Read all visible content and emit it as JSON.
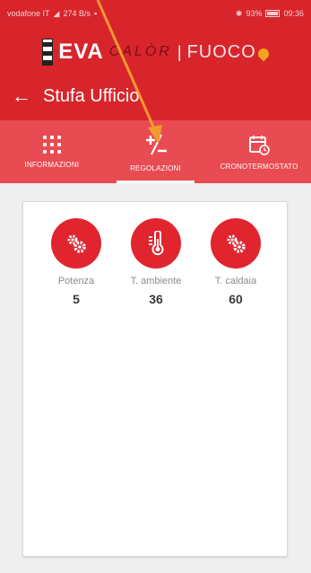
{
  "status_bar": {
    "carrier": "vodafone IT",
    "speed": "274 B/s",
    "battery": "93%",
    "time": "09:36"
  },
  "brand": {
    "eva": "EVA",
    "calor": "CALÒR",
    "fuoco": "FUOCO"
  },
  "appbar": {
    "title": "Stufa Ufficio"
  },
  "tabs": [
    {
      "label": "INFORMAZIONI",
      "icon": "grid-icon",
      "active": false
    },
    {
      "label": "REGOLAZIONI",
      "icon": "plus-minus-icon",
      "active": true
    },
    {
      "label": "CRONOTERMOSTATO",
      "icon": "calendar-clock-icon",
      "active": false
    }
  ],
  "regulations": [
    {
      "label": "Potenza",
      "value": "5",
      "icon": "gears-icon"
    },
    {
      "label": "T. ambiente",
      "value": "36",
      "icon": "thermometer-icon"
    },
    {
      "label": "T. caldaia",
      "value": "60",
      "icon": "gears-icon"
    }
  ],
  "colors": {
    "primary": "#d8252c",
    "tab_bar": "#e94b52",
    "icon_circle": "#e0252e",
    "annotation_arrow": "#f39a2c"
  }
}
